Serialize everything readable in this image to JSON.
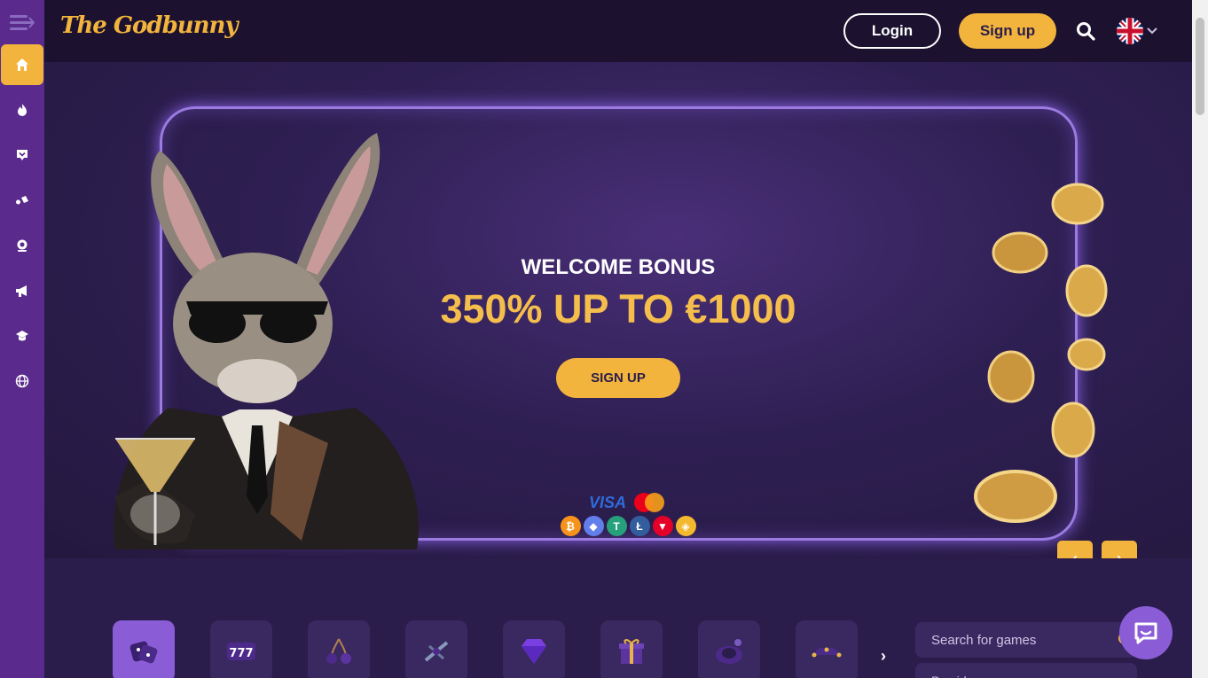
{
  "header": {
    "logo_text": "The Godbunny",
    "login_label": "Login",
    "signup_label": "Sign up",
    "search_icon": "search-icon",
    "language_flag": "uk-flag-icon"
  },
  "sidebar": {
    "toggle_icon": "menu-toggle-icon",
    "items": [
      {
        "icon": "home-icon"
      },
      {
        "icon": "fire-icon"
      },
      {
        "icon": "chat-icon"
      },
      {
        "icon": "sports-icon"
      },
      {
        "icon": "live-casino-icon"
      },
      {
        "icon": "megaphone-icon"
      },
      {
        "icon": "graduation-icon"
      },
      {
        "icon": "globe-icon"
      }
    ]
  },
  "hero": {
    "subtitle": "WELCOME BONUS",
    "title": "350% UP TO €1000",
    "cta_label": "SIGN UP",
    "payments": {
      "visa": "VISA",
      "mastercard": "MasterCard",
      "crypto": [
        {
          "name": "bitcoin",
          "symbol": "₿",
          "color": "#f7931a"
        },
        {
          "name": "ethereum",
          "symbol": "◆",
          "color": "#627eea"
        },
        {
          "name": "tether",
          "symbol": "T",
          "color": "#26a17b"
        },
        {
          "name": "litecoin",
          "symbol": "Ł",
          "color": "#345d9d"
        },
        {
          "name": "tron",
          "symbol": "▼",
          "color": "#e5002a"
        },
        {
          "name": "binance",
          "symbol": "◈",
          "color": "#f3ba2f"
        }
      ]
    },
    "prev_label": "‹",
    "next_label": "›"
  },
  "categories": {
    "items": [
      {
        "name": "dice"
      },
      {
        "name": "slots-777"
      },
      {
        "name": "cherries"
      },
      {
        "name": "crash-plane"
      },
      {
        "name": "diamond"
      },
      {
        "name": "gift"
      },
      {
        "name": "roulette-chip"
      },
      {
        "name": "jester-hat"
      }
    ],
    "next_label": "›",
    "search_placeholder": "Search for games",
    "provider_label": "Providers"
  },
  "colors": {
    "accent": "#f2b43c",
    "sidebar": "#5a2a8c",
    "background": "#2b1d4b",
    "header": "#1c1230"
  }
}
